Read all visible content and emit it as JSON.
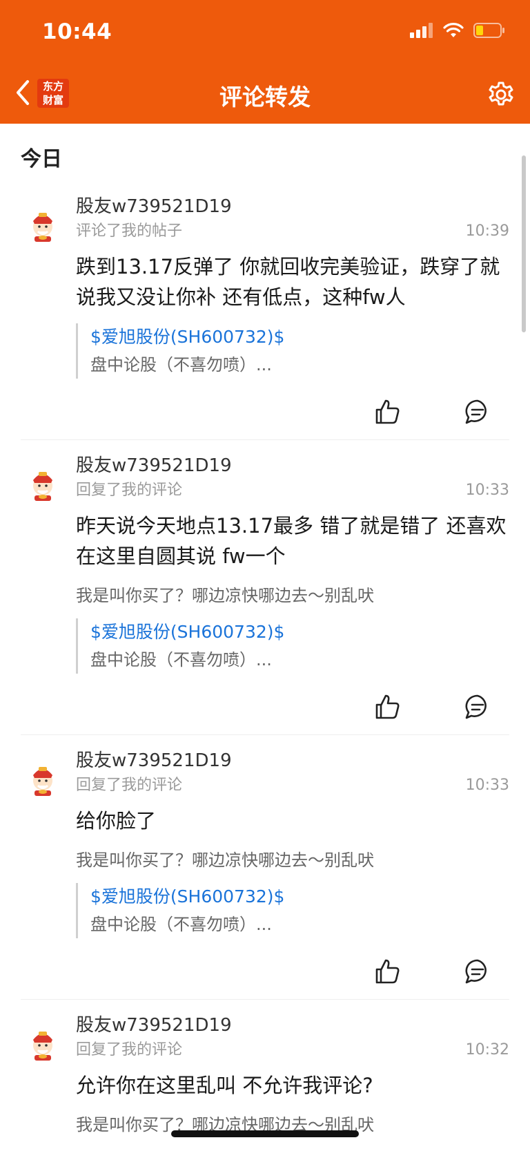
{
  "status_bar": {
    "time": "10:44"
  },
  "nav": {
    "title": "评论转发",
    "logo_line1": "东方",
    "logo_line2": "财富"
  },
  "section": {
    "title": "今日"
  },
  "colors": {
    "brand": "#EE5A0C",
    "link": "#1A73D9"
  },
  "items": [
    {
      "username": "股友w739521D19",
      "action": "评论了我的帖子",
      "time": "10:39",
      "content": "跌到13.17反弹了 你就回收完美验证，跌穿了就说我又没让你补 还有低点，这种fw人",
      "reply": "",
      "stock": "$爱旭股份(SH600732)$",
      "post_desc": "盘中论股（不喜勿喷）..."
    },
    {
      "username": "股友w739521D19",
      "action": "回复了我的评论",
      "time": "10:33",
      "content": "昨天说今天地点13.17最多 错了就是错了 还喜欢在这里自圆其说 fw一个",
      "reply": "我是叫你买了？哪边凉快哪边去～别乱吠",
      "stock": "$爱旭股份(SH600732)$",
      "post_desc": "盘中论股（不喜勿喷）..."
    },
    {
      "username": "股友w739521D19",
      "action": "回复了我的评论",
      "time": "10:33",
      "content": "给你脸了",
      "reply": "我是叫你买了？哪边凉快哪边去～别乱吠",
      "stock": "$爱旭股份(SH600732)$",
      "post_desc": "盘中论股（不喜勿喷）..."
    },
    {
      "username": "股友w739521D19",
      "action": "回复了我的评论",
      "time": "10:32",
      "content": "允许你在这里乱叫 不允许我评论?",
      "reply": "我是叫你买了？哪边凉快哪边去～别乱吠",
      "stock": "",
      "post_desc": ""
    }
  ]
}
